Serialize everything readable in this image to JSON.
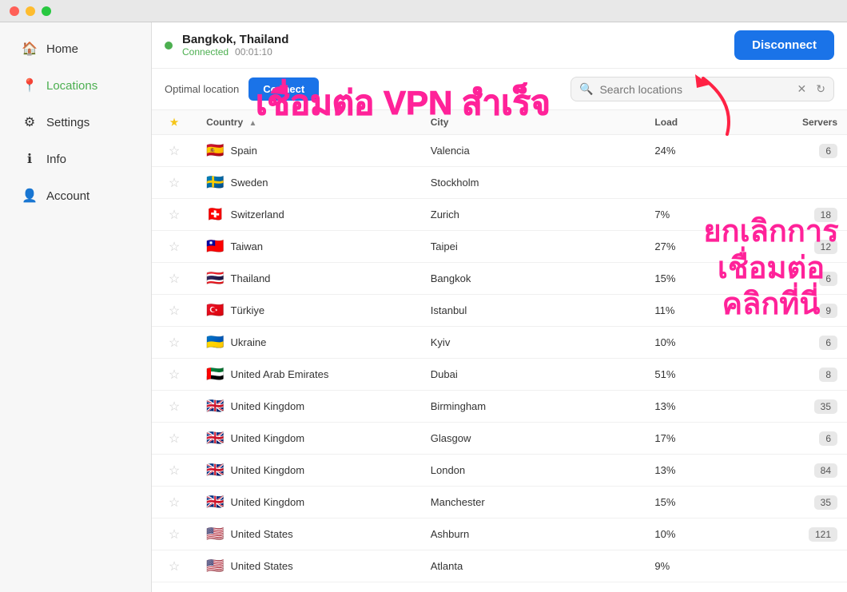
{
  "titlebar": {
    "buttons": [
      "close",
      "minimize",
      "maximize"
    ]
  },
  "sidebar": {
    "items": [
      {
        "id": "home",
        "label": "Home",
        "icon": "🏠",
        "active": false
      },
      {
        "id": "locations",
        "label": "Locations",
        "icon": "📍",
        "active": true
      },
      {
        "id": "settings",
        "label": "Settings",
        "icon": "⚙",
        "active": false
      },
      {
        "id": "info",
        "label": "Info",
        "icon": "ℹ",
        "active": false
      },
      {
        "id": "account",
        "label": "Account",
        "icon": "👤",
        "active": false
      }
    ]
  },
  "topbar": {
    "location_name": "Bangkok, Thailand",
    "status": "Connected",
    "time": "00:01:10",
    "disconnect_label": "Disconnect"
  },
  "action_bar": {
    "optimal_label": "Optimal location",
    "connect_label": "Connect",
    "search_placeholder": "Search locations",
    "refresh_icon": "↻"
  },
  "overlay": {
    "text1": "เชื่อมต่อ VPN สำเร็จ",
    "text2": "ยกเลิกการเชื่อมต่อ\nคลิกที่นี่"
  },
  "table": {
    "headers": {
      "star": "★",
      "country": "Country",
      "city": "City",
      "load": "Load",
      "servers": "Servers"
    },
    "rows": [
      {
        "star": "☆",
        "flag": "🇪🇸",
        "country": "Spain",
        "city": "Valencia",
        "load": "24%",
        "servers": "6"
      },
      {
        "star": "☆",
        "flag": "🇸🇪",
        "country": "Sweden",
        "city": "Stockholm",
        "load": "",
        "servers": ""
      },
      {
        "star": "☆",
        "flag": "🇨🇭",
        "country": "Switzerland",
        "city": "Zurich",
        "load": "7%",
        "servers": "18"
      },
      {
        "star": "☆",
        "flag": "🇹🇼",
        "country": "Taiwan",
        "city": "Taipei",
        "load": "27%",
        "servers": "12"
      },
      {
        "star": "☆",
        "flag": "🇹🇭",
        "country": "Thailand",
        "city": "Bangkok",
        "load": "15%",
        "servers": "6"
      },
      {
        "star": "☆",
        "flag": "🇹🇷",
        "country": "Türkiye",
        "city": "Istanbul",
        "load": "11%",
        "servers": "9"
      },
      {
        "star": "☆",
        "flag": "🇺🇦",
        "country": "Ukraine",
        "city": "Kyiv",
        "load": "10%",
        "servers": "6"
      },
      {
        "star": "☆",
        "flag": "🇦🇪",
        "country": "United Arab Emirates",
        "city": "Dubai",
        "load": "51%",
        "servers": "8"
      },
      {
        "star": "☆",
        "flag": "🇬🇧",
        "country": "United Kingdom",
        "city": "Birmingham",
        "load": "13%",
        "servers": "35"
      },
      {
        "star": "☆",
        "flag": "🇬🇧",
        "country": "United Kingdom",
        "city": "Glasgow",
        "load": "17%",
        "servers": "6"
      },
      {
        "star": "☆",
        "flag": "🇬🇧",
        "country": "United Kingdom",
        "city": "London",
        "load": "13%",
        "servers": "84"
      },
      {
        "star": "☆",
        "flag": "🇬🇧",
        "country": "United Kingdom",
        "city": "Manchester",
        "load": "15%",
        "servers": "35"
      },
      {
        "star": "☆",
        "flag": "🇺🇸",
        "country": "United States",
        "city": "Ashburn",
        "load": "10%",
        "servers": "121"
      },
      {
        "star": "☆",
        "flag": "🇺🇸",
        "country": "United States",
        "city": "Atlanta",
        "load": "9%",
        "servers": ""
      }
    ]
  }
}
